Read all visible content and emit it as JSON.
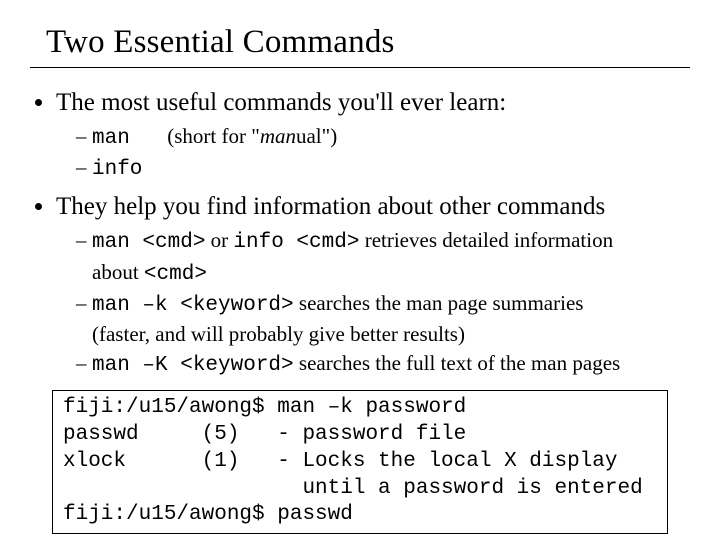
{
  "title": "Two Essential Commands",
  "bullet1": "The most useful commands you'll ever learn:",
  "sub1_cmd": "man",
  "sub1_note_a": "(short for \"",
  "sub1_note_em": "man",
  "sub1_note_b": "ual\")",
  "sub2_cmd": "info",
  "bullet2": "They help you find information about other commands",
  "sub3_a": "man <cmd>",
  "sub3_mid": " or ",
  "sub3_b": "info <cmd>",
  "sub3_tail": " retrieves detailed information",
  "sub3_cont_a": "about ",
  "sub3_cont_b": "<cmd>",
  "sub4_a": "man –k <keyword>",
  "sub4_tail": " searches the man page summaries",
  "sub4_cont": "(faster, and will probably give better results)",
  "sub5_a": "man –K <keyword>",
  "sub5_tail": " searches the full text of the man pages",
  "terminal": "fiji:/u15/awong$ man –k password\npasswd     (5)   - password file\nxlock      (1)   - Locks the local X display\n                   until a password is entered\nfiji:/u15/awong$ passwd"
}
